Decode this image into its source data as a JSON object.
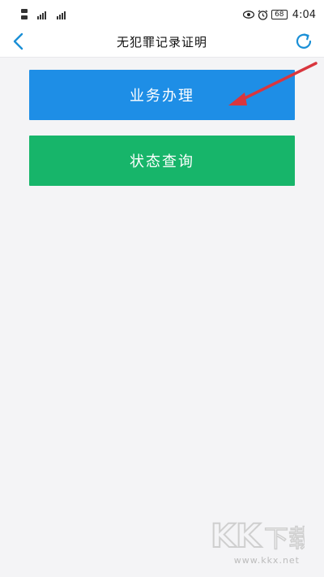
{
  "status_bar": {
    "battery": "68",
    "time": "4:04"
  },
  "nav": {
    "title": "无犯罪记录证明"
  },
  "actions": {
    "business_label": "业务办理",
    "status_label": "状态查询"
  },
  "watermark": {
    "logo_text": "KK下载",
    "url": "www.kkx.net"
  },
  "colors": {
    "business_button": "#1e8ee6",
    "status_button": "#17b56a",
    "nav_icon": "#1a8fd6",
    "annotation_arrow": "#d9363e"
  }
}
